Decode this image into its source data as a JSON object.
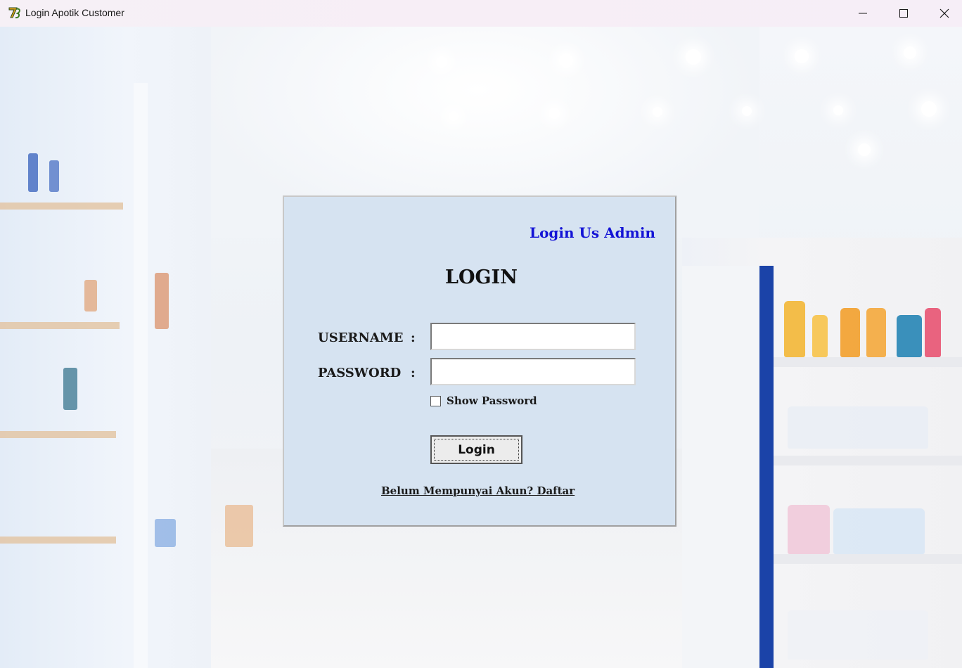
{
  "window": {
    "title": "Login Apotik Customer",
    "app_icon": "java-app-icon",
    "controls": [
      "minimize-icon",
      "maximize-icon",
      "close-icon"
    ]
  },
  "login_panel": {
    "admin_link": "Login Us Admin",
    "heading": "LOGIN",
    "username_label": "USERNAME",
    "password_label": "PASSWORD",
    "colon": ":",
    "username_value": "",
    "password_value": "",
    "show_password_label": "Show Password",
    "show_password_checked": false,
    "login_button": "Login",
    "register_link": "Belum Mempunyai Akun? Daftar"
  },
  "colors": {
    "panel_bg": "#d6e3f1",
    "admin_link": "#1414d6",
    "shelf_post": "#1b43a8"
  }
}
